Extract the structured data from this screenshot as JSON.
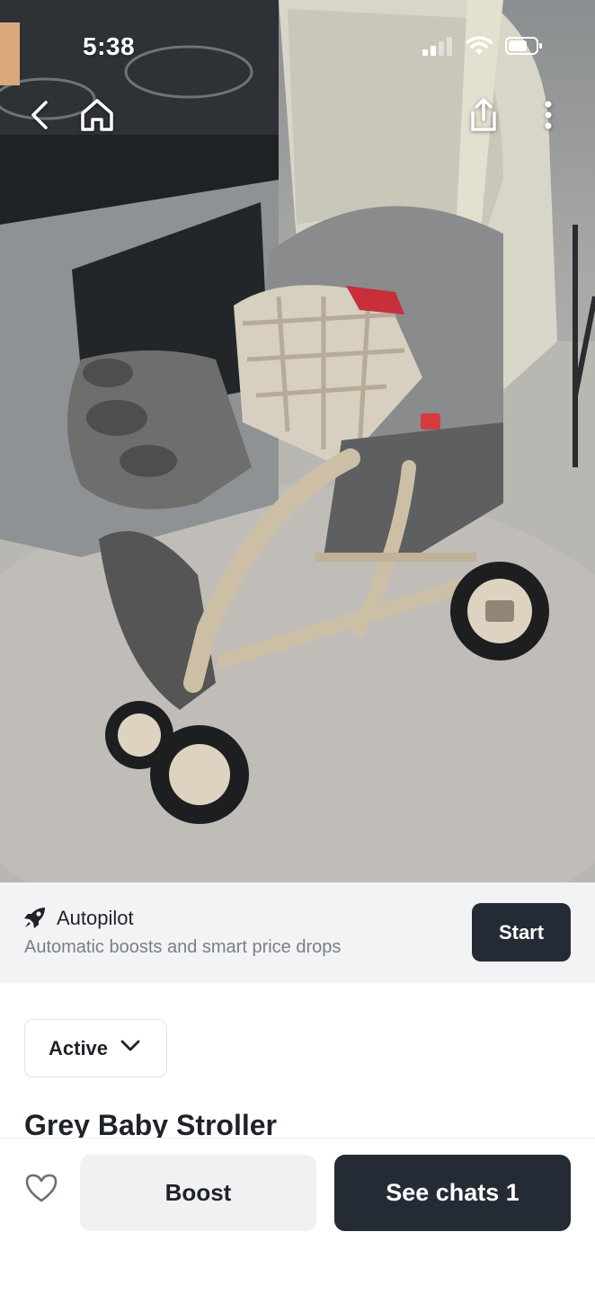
{
  "status_bar": {
    "time": "5:38"
  },
  "nav": {
    "back_icon": "chevron-left-icon",
    "home_icon": "home-icon",
    "share_icon": "share-icon",
    "more_icon": "more-vertical-icon"
  },
  "photo": {
    "description_icon": "listing-photo"
  },
  "autopilot": {
    "icon": "rocket-icon",
    "title": "Autopilot",
    "subtitle": "Automatic boosts and smart price drops",
    "start_label": "Start"
  },
  "listing": {
    "status_label": "Active",
    "title": "Grey Baby Stroller"
  },
  "actions": {
    "favorite_icon": "heart-outline-icon",
    "boost_label": "Boost",
    "chats_label": "See chats 1"
  },
  "colors": {
    "dark_button": "#242b35",
    "banner_bg": "#f2f3f5",
    "muted_text": "#7a7f86"
  }
}
